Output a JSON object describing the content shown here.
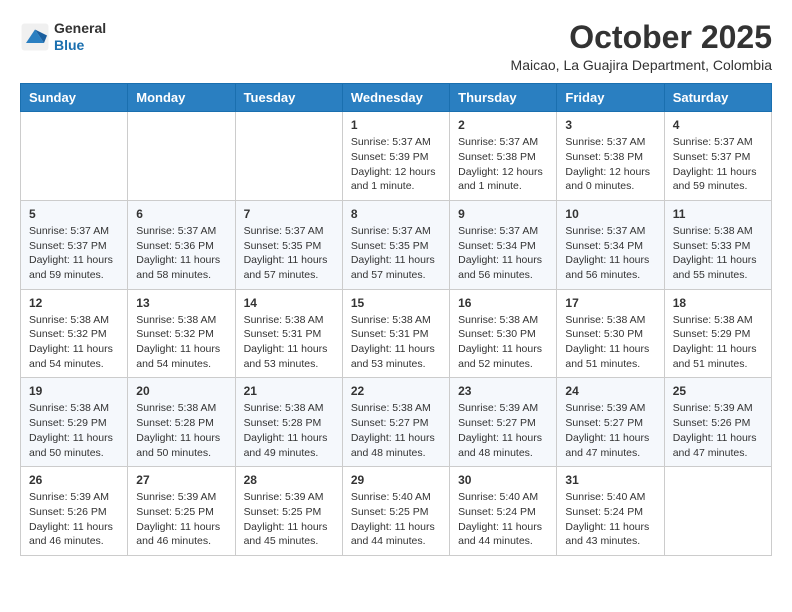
{
  "header": {
    "logo_line1": "General",
    "logo_line2": "Blue",
    "month_year": "October 2025",
    "location": "Maicao, La Guajira Department, Colombia"
  },
  "days_of_week": [
    "Sunday",
    "Monday",
    "Tuesday",
    "Wednesday",
    "Thursday",
    "Friday",
    "Saturday"
  ],
  "weeks": [
    [
      {
        "day": "",
        "info": ""
      },
      {
        "day": "",
        "info": ""
      },
      {
        "day": "",
        "info": ""
      },
      {
        "day": "1",
        "info": "Sunrise: 5:37 AM\nSunset: 5:39 PM\nDaylight: 12 hours\nand 1 minute."
      },
      {
        "day": "2",
        "info": "Sunrise: 5:37 AM\nSunset: 5:38 PM\nDaylight: 12 hours\nand 1 minute."
      },
      {
        "day": "3",
        "info": "Sunrise: 5:37 AM\nSunset: 5:38 PM\nDaylight: 12 hours\nand 0 minutes."
      },
      {
        "day": "4",
        "info": "Sunrise: 5:37 AM\nSunset: 5:37 PM\nDaylight: 11 hours\nand 59 minutes."
      }
    ],
    [
      {
        "day": "5",
        "info": "Sunrise: 5:37 AM\nSunset: 5:37 PM\nDaylight: 11 hours\nand 59 minutes."
      },
      {
        "day": "6",
        "info": "Sunrise: 5:37 AM\nSunset: 5:36 PM\nDaylight: 11 hours\nand 58 minutes."
      },
      {
        "day": "7",
        "info": "Sunrise: 5:37 AM\nSunset: 5:35 PM\nDaylight: 11 hours\nand 57 minutes."
      },
      {
        "day": "8",
        "info": "Sunrise: 5:37 AM\nSunset: 5:35 PM\nDaylight: 11 hours\nand 57 minutes."
      },
      {
        "day": "9",
        "info": "Sunrise: 5:37 AM\nSunset: 5:34 PM\nDaylight: 11 hours\nand 56 minutes."
      },
      {
        "day": "10",
        "info": "Sunrise: 5:37 AM\nSunset: 5:34 PM\nDaylight: 11 hours\nand 56 minutes."
      },
      {
        "day": "11",
        "info": "Sunrise: 5:38 AM\nSunset: 5:33 PM\nDaylight: 11 hours\nand 55 minutes."
      }
    ],
    [
      {
        "day": "12",
        "info": "Sunrise: 5:38 AM\nSunset: 5:32 PM\nDaylight: 11 hours\nand 54 minutes."
      },
      {
        "day": "13",
        "info": "Sunrise: 5:38 AM\nSunset: 5:32 PM\nDaylight: 11 hours\nand 54 minutes."
      },
      {
        "day": "14",
        "info": "Sunrise: 5:38 AM\nSunset: 5:31 PM\nDaylight: 11 hours\nand 53 minutes."
      },
      {
        "day": "15",
        "info": "Sunrise: 5:38 AM\nSunset: 5:31 PM\nDaylight: 11 hours\nand 53 minutes."
      },
      {
        "day": "16",
        "info": "Sunrise: 5:38 AM\nSunset: 5:30 PM\nDaylight: 11 hours\nand 52 minutes."
      },
      {
        "day": "17",
        "info": "Sunrise: 5:38 AM\nSunset: 5:30 PM\nDaylight: 11 hours\nand 51 minutes."
      },
      {
        "day": "18",
        "info": "Sunrise: 5:38 AM\nSunset: 5:29 PM\nDaylight: 11 hours\nand 51 minutes."
      }
    ],
    [
      {
        "day": "19",
        "info": "Sunrise: 5:38 AM\nSunset: 5:29 PM\nDaylight: 11 hours\nand 50 minutes."
      },
      {
        "day": "20",
        "info": "Sunrise: 5:38 AM\nSunset: 5:28 PM\nDaylight: 11 hours\nand 50 minutes."
      },
      {
        "day": "21",
        "info": "Sunrise: 5:38 AM\nSunset: 5:28 PM\nDaylight: 11 hours\nand 49 minutes."
      },
      {
        "day": "22",
        "info": "Sunrise: 5:38 AM\nSunset: 5:27 PM\nDaylight: 11 hours\nand 48 minutes."
      },
      {
        "day": "23",
        "info": "Sunrise: 5:39 AM\nSunset: 5:27 PM\nDaylight: 11 hours\nand 48 minutes."
      },
      {
        "day": "24",
        "info": "Sunrise: 5:39 AM\nSunset: 5:27 PM\nDaylight: 11 hours\nand 47 minutes."
      },
      {
        "day": "25",
        "info": "Sunrise: 5:39 AM\nSunset: 5:26 PM\nDaylight: 11 hours\nand 47 minutes."
      }
    ],
    [
      {
        "day": "26",
        "info": "Sunrise: 5:39 AM\nSunset: 5:26 PM\nDaylight: 11 hours\nand 46 minutes."
      },
      {
        "day": "27",
        "info": "Sunrise: 5:39 AM\nSunset: 5:25 PM\nDaylight: 11 hours\nand 46 minutes."
      },
      {
        "day": "28",
        "info": "Sunrise: 5:39 AM\nSunset: 5:25 PM\nDaylight: 11 hours\nand 45 minutes."
      },
      {
        "day": "29",
        "info": "Sunrise: 5:40 AM\nSunset: 5:25 PM\nDaylight: 11 hours\nand 44 minutes."
      },
      {
        "day": "30",
        "info": "Sunrise: 5:40 AM\nSunset: 5:24 PM\nDaylight: 11 hours\nand 44 minutes."
      },
      {
        "day": "31",
        "info": "Sunrise: 5:40 AM\nSunset: 5:24 PM\nDaylight: 11 hours\nand 43 minutes."
      },
      {
        "day": "",
        "info": ""
      }
    ]
  ]
}
